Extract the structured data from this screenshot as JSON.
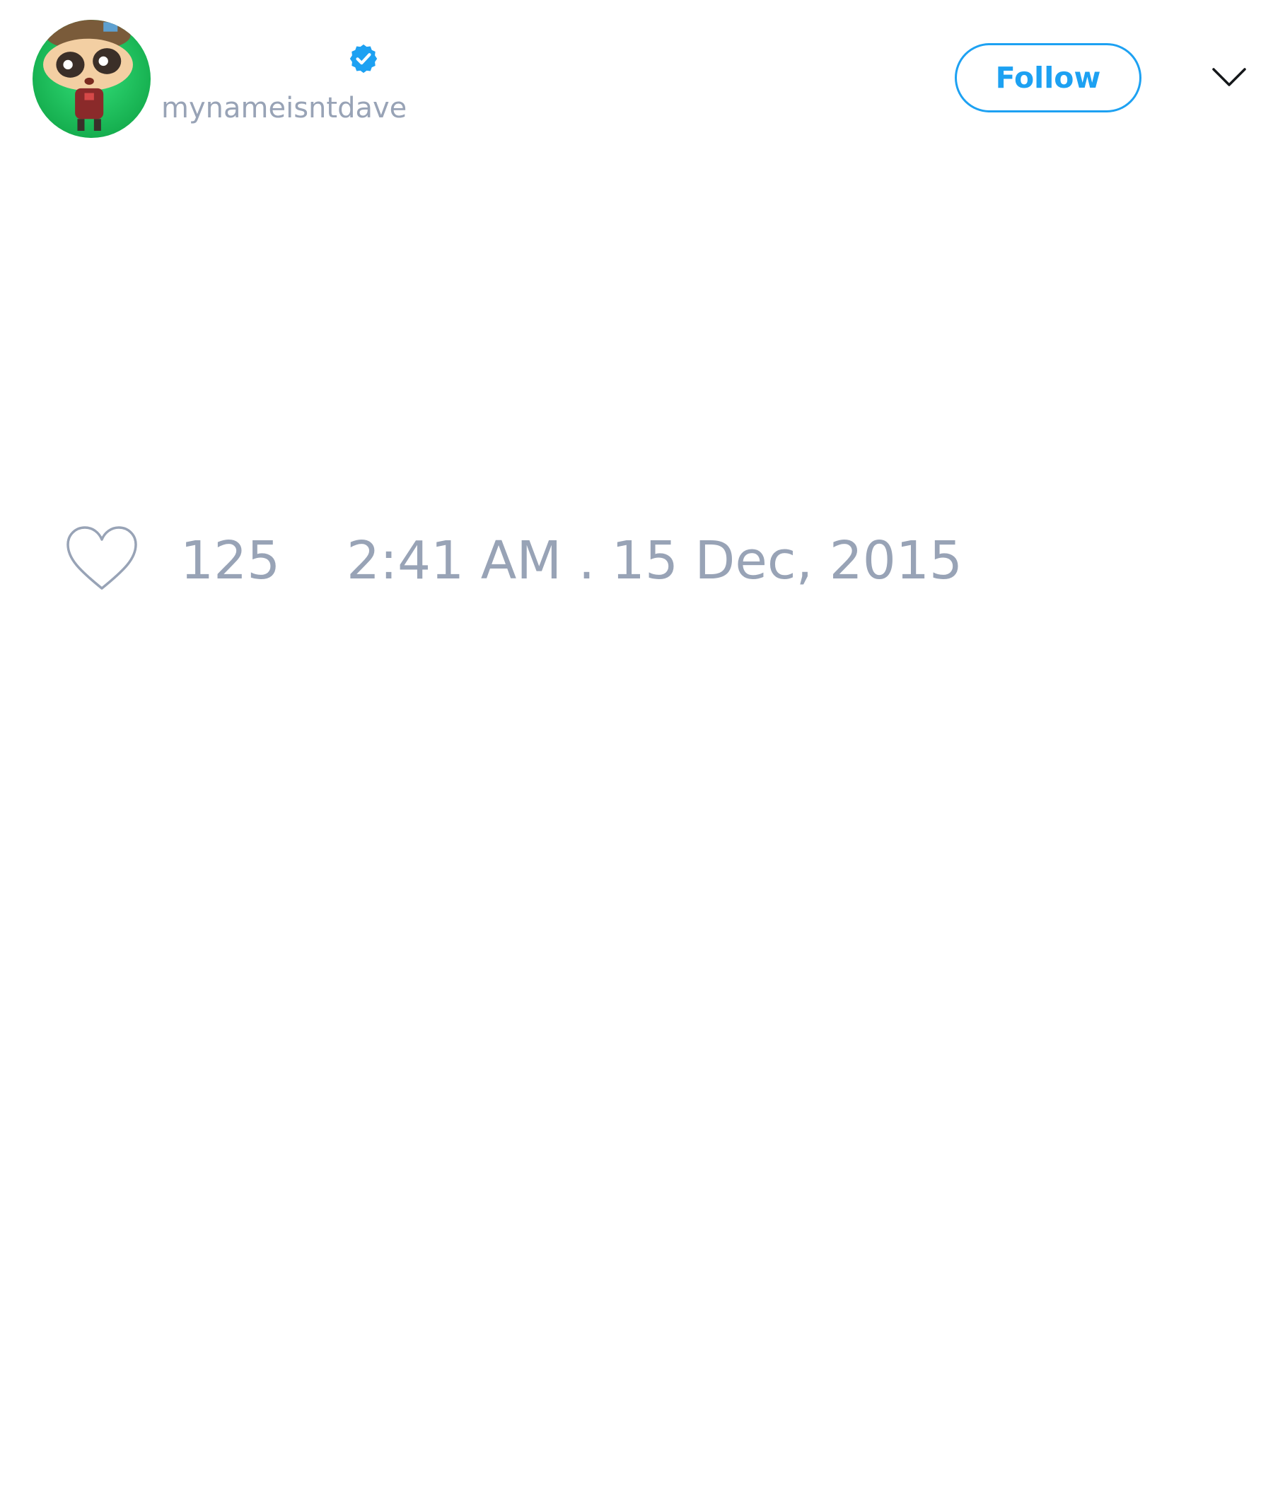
{
  "tweet": {
    "author": {
      "display_name": "",
      "handle": "mynameisntdave",
      "verified": true,
      "avatar_icon": "cartoon-character-avatar"
    },
    "actions": {
      "follow_label": "Follow",
      "menu_icon": "chevron-down-icon"
    },
    "footer": {
      "like_icon": "heart-outline-icon",
      "like_count": "125",
      "timestamp": "2:41 AM . 15 Dec, 2015"
    }
  },
  "colors": {
    "accent": "#1da1f2",
    "muted_text": "#98a3b6",
    "avatar_bg": "#1fd165",
    "background": "#ffffff"
  }
}
